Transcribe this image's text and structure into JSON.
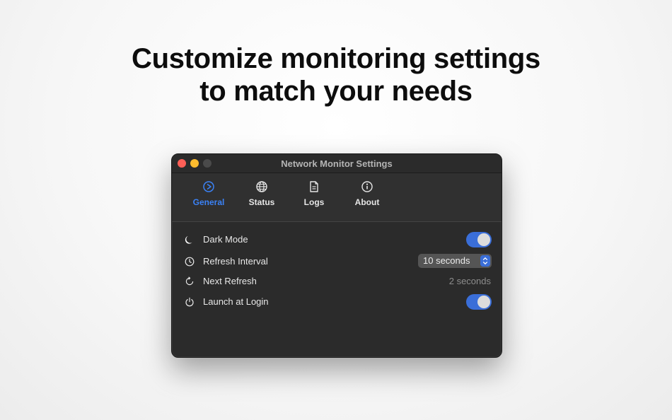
{
  "headline": {
    "line1": "Customize monitoring settings",
    "line2": "to match your needs"
  },
  "window": {
    "title": "Network Monitor Settings"
  },
  "tabs": [
    {
      "label": "General",
      "icon": "gear-icon",
      "active": true
    },
    {
      "label": "Status",
      "icon": "globe-icon",
      "active": false
    },
    {
      "label": "Logs",
      "icon": "document-icon",
      "active": false
    },
    {
      "label": "About",
      "icon": "info-icon",
      "active": false
    }
  ],
  "settings": {
    "dark_mode": {
      "label": "Dark Mode",
      "icon": "moon-icon",
      "enabled": true
    },
    "refresh_interval": {
      "label": "Refresh Interval",
      "icon": "clock-icon",
      "value": "10 seconds"
    },
    "next_refresh": {
      "label": "Next Refresh",
      "icon": "refresh-icon",
      "value": "2 seconds"
    },
    "launch_at_login": {
      "label": "Launch at Login",
      "icon": "power-icon",
      "enabled": true
    }
  },
  "colors": {
    "accent": "#3b82f6",
    "toggle_on": "#3a6ed8",
    "window_bg": "#2b2b2b",
    "close": "#ff5f57",
    "minimize": "#febc2e"
  }
}
